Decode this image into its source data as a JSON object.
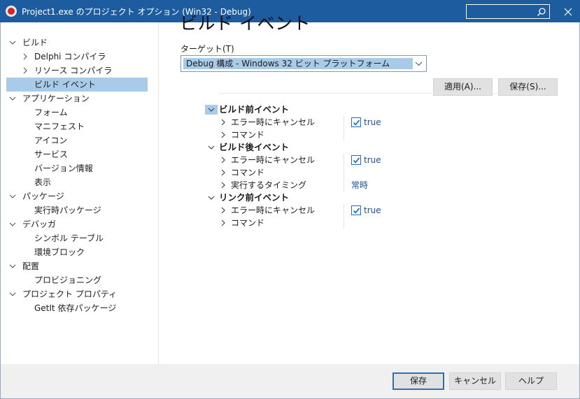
{
  "window": {
    "title": "Project1.exe のプロジェクト オプション  (Win32 - Debug)",
    "search_placeholder": ""
  },
  "nav": {
    "items": [
      {
        "label": "ビルド",
        "chevron": "down"
      },
      {
        "label": "Delphi コンパイラ",
        "chevron": "right"
      },
      {
        "label": "リソース コンパイラ",
        "chevron": "right"
      },
      {
        "label": "ビルド イベント",
        "selected": true
      },
      {
        "label": "アプリケーション",
        "chevron": "down"
      },
      {
        "label": "フォーム"
      },
      {
        "label": "マニフェスト"
      },
      {
        "label": "アイコン"
      },
      {
        "label": "サービス"
      },
      {
        "label": "バージョン情報"
      },
      {
        "label": "表示"
      },
      {
        "label": "パッケージ",
        "chevron": "down"
      },
      {
        "label": "実行時パッケージ"
      },
      {
        "label": "デバッガ",
        "chevron": "down"
      },
      {
        "label": "シンボル テーブル"
      },
      {
        "label": "環境ブロック"
      },
      {
        "label": "配置",
        "chevron": "down"
      },
      {
        "label": "プロビジョニング"
      },
      {
        "label": "プロジェクト プロパティ",
        "chevron": "down"
      },
      {
        "label": "GetIt 依存パッケージ"
      }
    ]
  },
  "main": {
    "title": "ビルド イベント",
    "target_label": "ターゲット(T)",
    "target_value": "Debug 構成 - Windows 32 ビット プラットフォーム",
    "apply_button": "適用(A)...",
    "save_button": "保存(S)...",
    "groups": [
      {
        "label": "ビルド前イベント",
        "rows": [
          {
            "label": "エラー時にキャンセル",
            "value": "true",
            "checked": true
          },
          {
            "label": "コマンド",
            "value": ""
          }
        ]
      },
      {
        "label": "ビルド後イベント",
        "rows": [
          {
            "label": "エラー時にキャンセル",
            "value": "true",
            "checked": true
          },
          {
            "label": "コマンド",
            "value": ""
          },
          {
            "label": "実行するタイミング",
            "value": "常時"
          }
        ]
      },
      {
        "label": "リンク前イベント",
        "rows": [
          {
            "label": "エラー時にキャンセル",
            "value": "true",
            "checked": true
          },
          {
            "label": "コマンド",
            "value": ""
          }
        ]
      }
    ]
  },
  "footer": {
    "save": "保存",
    "cancel": "キャンセル",
    "help": "ヘルプ"
  }
}
